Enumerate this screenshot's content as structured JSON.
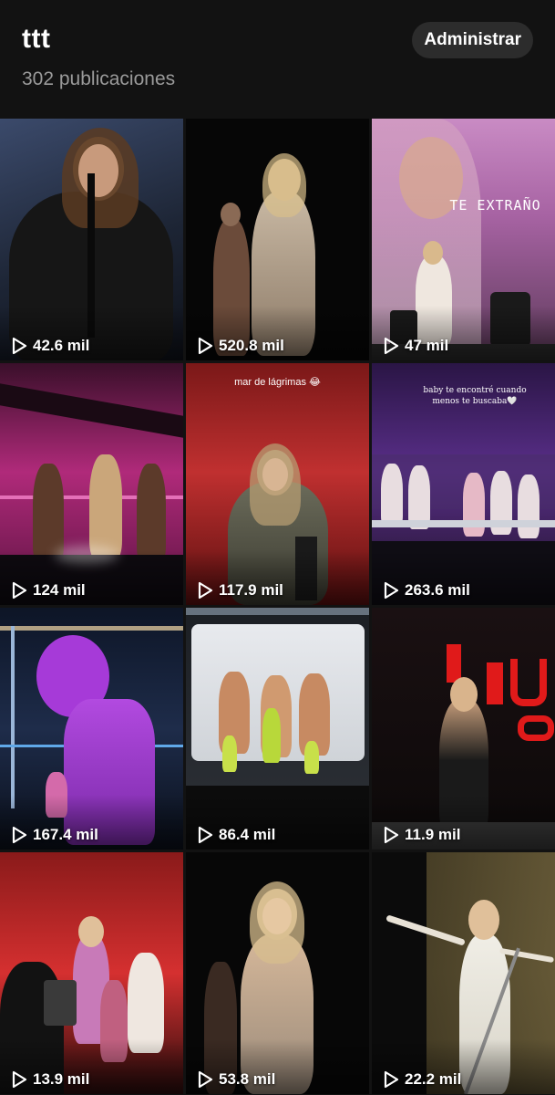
{
  "profile": {
    "title": "ttt",
    "posts_count": "302 publicaciones",
    "admin_button": "Administrar"
  },
  "posts": [
    {
      "views": "42.6 mil",
      "overlay": ""
    },
    {
      "views": "520.8 mil",
      "overlay": ""
    },
    {
      "views": "47 mil",
      "overlay": "TE EXTRAÑO"
    },
    {
      "views": "124 mil",
      "overlay": ""
    },
    {
      "views": "117.9 mil",
      "overlay": "mar de lágrimas 😂"
    },
    {
      "views": "263.6 mil",
      "overlay": "baby te encontré cuando menos te buscaba🤍"
    },
    {
      "views": "167.4 mil",
      "overlay": ""
    },
    {
      "views": "86.4 mil",
      "overlay": ""
    },
    {
      "views": "11.9 mil",
      "overlay": ""
    },
    {
      "views": "13.9 mil",
      "overlay": ""
    },
    {
      "views": "53.8 mil",
      "overlay": ""
    },
    {
      "views": "22.2 mil",
      "overlay": ""
    }
  ],
  "colors": {
    "background": "#121212",
    "button_bg": "#2c2c2c",
    "muted_text": "#9a9a9a"
  },
  "icons": {
    "play": "play-icon"
  }
}
